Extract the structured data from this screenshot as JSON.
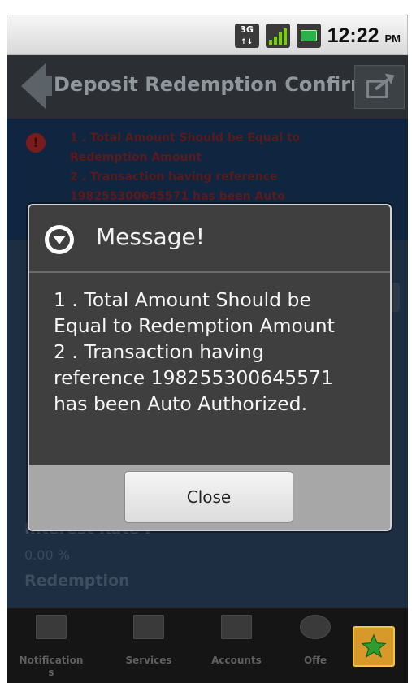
{
  "status_bar": {
    "network": "3G",
    "network_sub": "↑↓",
    "time": "12:22",
    "ampm": "PM"
  },
  "header": {
    "title": "Deposit Redemption Confirm",
    "back_icon": "back-arrow-icon",
    "share_icon": "share-icon"
  },
  "background": {
    "error_lines": [
      "1 . Total Amount Should be Equal to",
      "Redemption Amount",
      "2 . Transaction having reference",
      "198255300645571 has been Auto"
    ],
    "labels": [
      "Interest Rate :",
      "Redemption"
    ],
    "interest_value": "0.00 %"
  },
  "dialog": {
    "title": "Message!",
    "lines": [
      "1 . Total Amount Should be",
      "Equal to Redemption Amount",
      "2 . Transaction having",
      "reference 198255300645571",
      "has been Auto Authorized."
    ],
    "close_label": "Close"
  },
  "bottom_nav": {
    "items": [
      {
        "label_line1": "Notification",
        "label_line2": "s",
        "icon": "notifications-icon"
      },
      {
        "label_line1": "Services",
        "label_line2": "",
        "icon": "services-icon"
      },
      {
        "label_line1": "Accounts",
        "label_line2": "",
        "icon": "accounts-icon"
      },
      {
        "label_line1": "Offe",
        "label_line2": "",
        "icon": "offers-icon"
      }
    ],
    "favorite_icon": "star-icon"
  },
  "colors": {
    "dialog_bg": "#3f3f3f",
    "dialog_border": "#cfd3d6",
    "footer_bg": "#a7a7a7",
    "star_bg": "#d79a2a",
    "star_fill": "#2e9c2e"
  }
}
